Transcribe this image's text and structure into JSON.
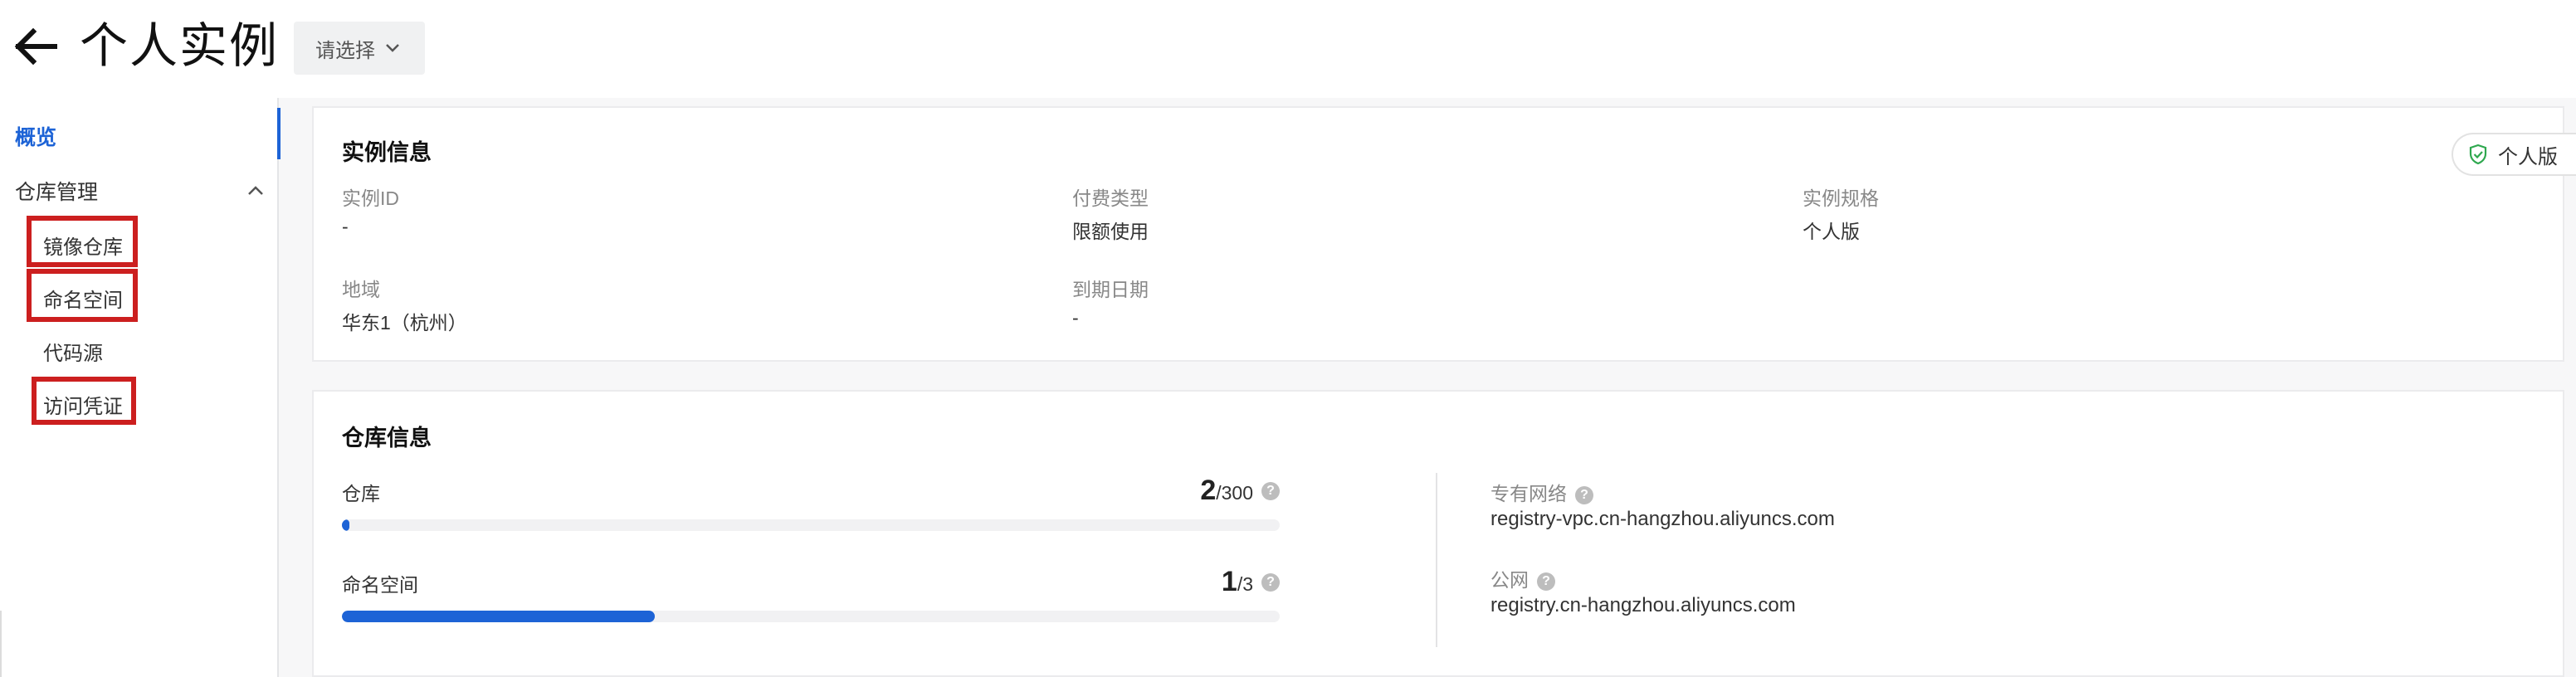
{
  "header": {
    "title": "个人实例",
    "select_label": "请选择"
  },
  "sidebar": {
    "overview": "概览",
    "group_label": "仓库管理",
    "items": [
      {
        "label": "镜像仓库"
      },
      {
        "label": "命名空间"
      },
      {
        "label": "代码源"
      },
      {
        "label": "访问凭证"
      }
    ]
  },
  "instance_info": {
    "title": "实例信息",
    "badge": "个人版",
    "fields": {
      "instance_id_label": "实例ID",
      "instance_id_value": "-",
      "billing_label": "付费类型",
      "billing_value": "限额使用",
      "spec_label": "实例规格",
      "spec_value": "个人版",
      "region_label": "地域",
      "region_value": "华东1（杭州）",
      "expire_label": "到期日期",
      "expire_value": "-"
    }
  },
  "repo_info": {
    "title": "仓库信息",
    "repo": {
      "label": "仓库",
      "used": "2",
      "limit": "/300",
      "fraction": 0.0067
    },
    "namespace": {
      "label": "命名空间",
      "used": "1",
      "limit": "/3",
      "fraction": 0.3333
    },
    "vpc_label": "专有网络",
    "vpc_value": "registry-vpc.cn-hangzhou.aliyuncs.com",
    "public_label": "公网",
    "public_value": "registry.cn-hangzhou.aliyuncs.com"
  },
  "colors": {
    "accent": "#1d63d6",
    "highlight_box": "#cc1f1f",
    "badge_icon": "#2fa84f"
  },
  "icons": {
    "back": "arrow-left-icon",
    "select_caret": "chevron-down-icon",
    "group_caret": "chevron-up-icon",
    "badge": "shield-check-icon",
    "help": "question-circle-icon"
  }
}
